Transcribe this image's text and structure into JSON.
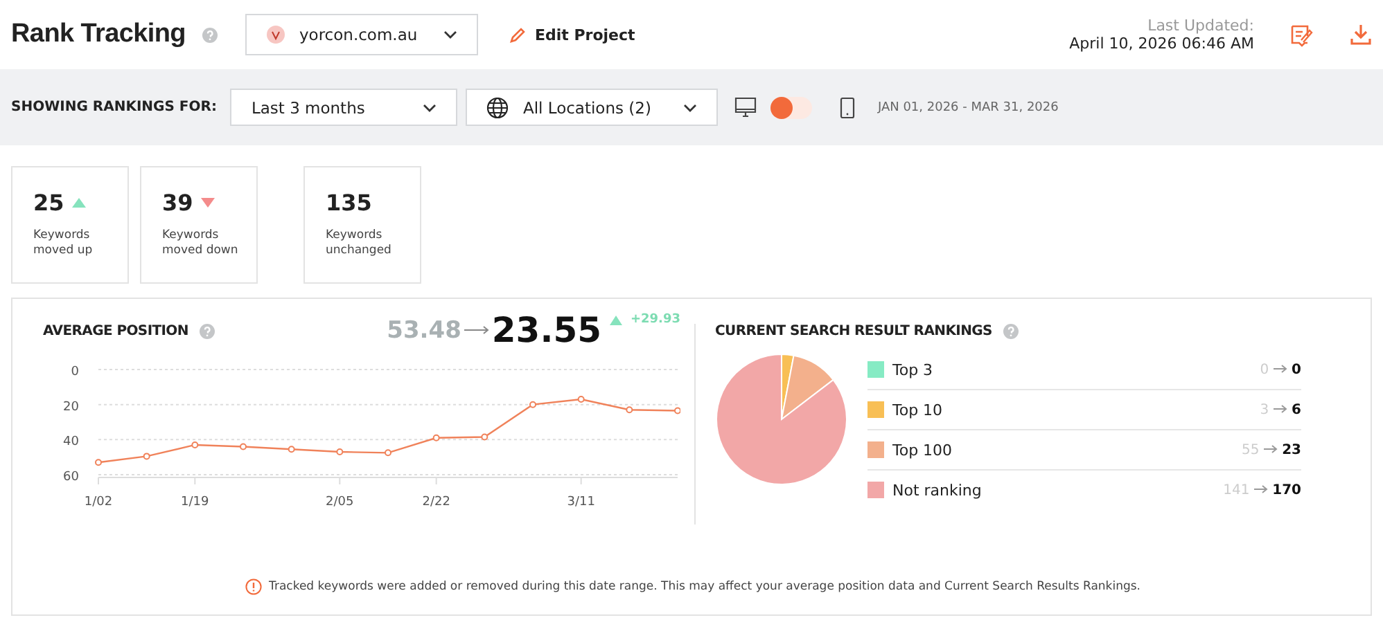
{
  "header": {
    "title": "Rank Tracking",
    "project": "yorcon.com.au",
    "edit_label": "Edit Project",
    "last_updated_label": "Last Updated:",
    "last_updated": "April 10, 2026 06:46 AM"
  },
  "filters": {
    "label": "SHOWING RANKINGS FOR:",
    "period": "Last 3 months",
    "locations": "All Locations (2)",
    "device_switch": {
      "on": false
    },
    "date_range": "JAN 01, 2026 - MAR 31, 2026"
  },
  "stats": [
    {
      "value": "25",
      "label": "Keywords moved up",
      "kind": "up"
    },
    {
      "value": "39",
      "label": "Keywords moved down",
      "kind": "down"
    },
    {
      "value": "135",
      "label": "Keywords unchanged",
      "kind": "plain"
    }
  ],
  "average_position": {
    "title": "AVERAGE POSITION",
    "previous": "53.48",
    "current": "23.55",
    "change": "+29.93",
    "chart_data": {
      "type": "line",
      "categories": [
        "1/02",
        null,
        "1/19",
        null,
        null,
        "2/05",
        null,
        "2/22",
        null,
        null,
        "3/11",
        null,
        null
      ],
      "series": [
        {
          "color": "#f0825a",
          "marker": "circle",
          "values": [
            53,
            49.5,
            43,
            44,
            45.5,
            47,
            47.5,
            39,
            38.5,
            20,
            17,
            23,
            23.5
          ]
        }
      ],
      "ylim": [
        60,
        0
      ],
      "yticks": [
        0,
        20,
        40,
        60
      ]
    }
  },
  "search_rankings": {
    "title": "CURRENT SEARCH RESULT RANKINGS",
    "chart_data": {
      "type": "pie",
      "values": [
        0,
        3,
        11.6,
        85.4
      ]
    },
    "legend": [
      {
        "label": "Top 3",
        "color": "#86ebc4",
        "previous": "0",
        "current": "0"
      },
      {
        "label": "Top 10",
        "color": "#f8bf55",
        "previous": "3",
        "current": "6"
      },
      {
        "label": "Top 100",
        "color": "#f3b08c",
        "previous": "55",
        "current": "23"
      },
      {
        "label": "Not ranking",
        "color": "#f2a7a7",
        "previous": "141",
        "current": "170"
      }
    ]
  },
  "notice": "Tracked keywords were added or removed during this date range. This may affect your average position data and Current Search Results Rankings."
}
